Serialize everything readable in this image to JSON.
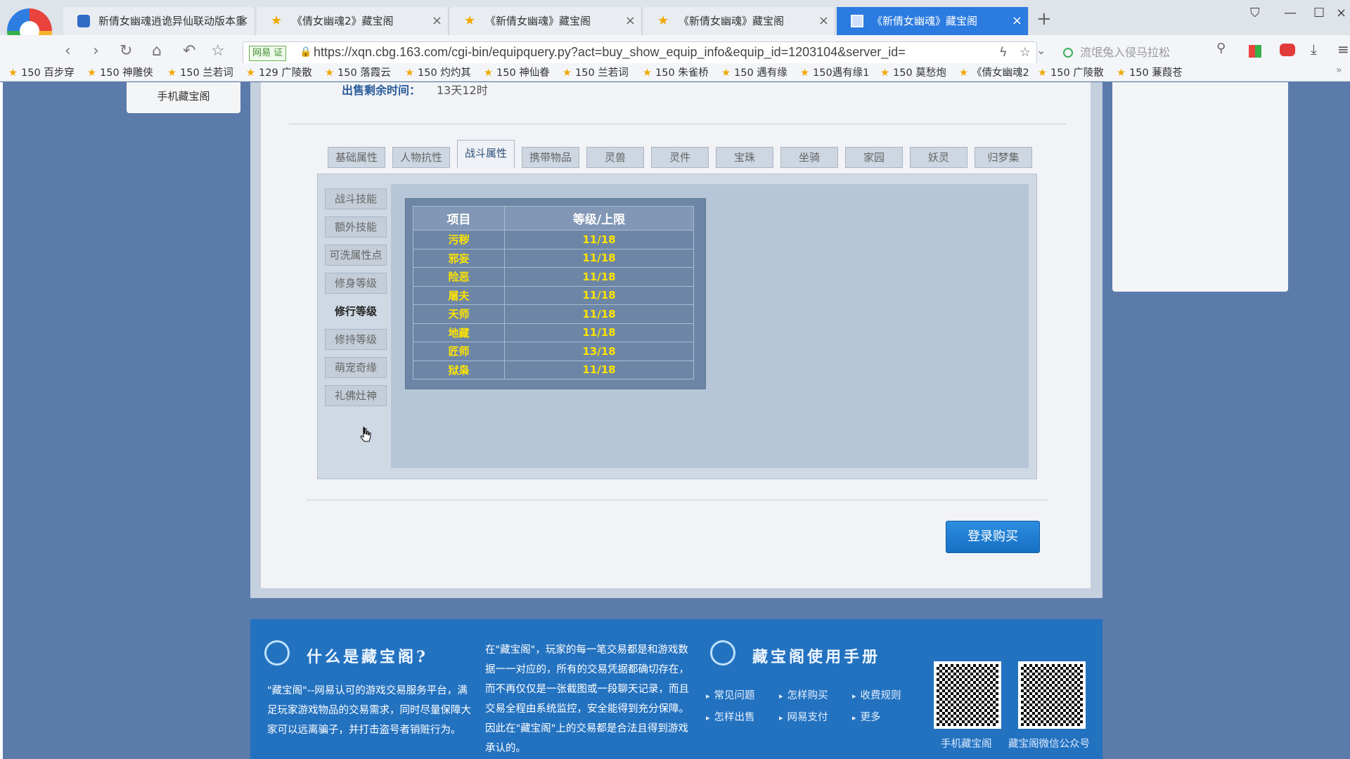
{
  "browser": {
    "tabs": [
      {
        "title": "新倩女幽魂逍诡异仙联动版本重",
        "icon": "game-icon"
      },
      {
        "title": "《倩女幽魂2》藏宝阁",
        "icon": "star-icon"
      },
      {
        "title": "《新倩女幽魂》藏宝阁",
        "icon": "star-icon"
      },
      {
        "title": "《新倩女幽魂》藏宝阁",
        "icon": "star-icon"
      },
      {
        "title": "《新倩女幽魂》藏宝阁",
        "icon": "page-icon",
        "active": true
      }
    ],
    "secure_badge": "网易 证",
    "url": "https://xqn.cbg.163.com/cgi-bin/equipquery.py?act=buy_show_equip_info&equip_id=1203104&server_id=",
    "search_placeholder": "流氓兔入侵马拉松",
    "bookmarks": [
      "150 百步穿",
      "150 神雕侠",
      "150 兰若词",
      "129 广陵散",
      "150 落霞云",
      "150 灼灼其",
      "150 神仙眷",
      "150 兰若词",
      "150 朱雀桥",
      "150 遇有缘",
      "150遇有缘1",
      "150 莫愁炮",
      "《倩女幽魂2",
      "150 广陵散",
      "150 蒹葭苍"
    ]
  },
  "page": {
    "mobile_cbg": "手机藏宝阁",
    "remaining_label": "出售剩余时间：",
    "remaining_value": "13天12时",
    "tabs": [
      "基础属性",
      "人物抗性",
      "战斗属性",
      "携带物品",
      "灵兽",
      "灵件",
      "宝珠",
      "坐骑",
      "家园",
      "妖灵",
      "归梦集"
    ],
    "active_tab": "战斗属性",
    "side_menu": [
      "战斗技能",
      "额外技能",
      "可洗属性点",
      "修身等级",
      "修行等级",
      "修持等级",
      "萌宠奇缘",
      "礼佛灶神"
    ],
    "active_side": "修行等级",
    "table": {
      "headers": [
        "项目",
        "等级/上限"
      ],
      "rows": [
        [
          "污秽",
          "11/18"
        ],
        [
          "邪妄",
          "11/18"
        ],
        [
          "险恶",
          "11/18"
        ],
        [
          "屠夫",
          "11/18"
        ],
        [
          "天师",
          "11/18"
        ],
        [
          "地藏",
          "11/18"
        ],
        [
          "匠师",
          "13/18"
        ],
        [
          "狱枭",
          "11/18"
        ]
      ]
    },
    "buy_button": "登录购买"
  },
  "footer": {
    "what_title": "什么是藏宝阁?",
    "what_text": "\"藏宝阁\"--网易认可的游戏交易服务平台，满足玩家游戏物品的交易需求，同时尽量保障大家可以远离骗子，并打击盗号者销赃行为。",
    "middle_text": "在\"藏宝阁\"，玩家的每一笔交易都是和游戏数据一一对应的，所有的交易凭据都确切存在，而不再仅仅是一张截图或一段聊天记录，而且交易全程由系统监控，安全能得到充分保障。因此在\"藏宝阁\"上的交易都是合法且得到游戏承认的。",
    "manual_title": "藏宝阁使用手册",
    "links": [
      "常见问题",
      "怎样购买",
      "收费规则",
      "怎样出售",
      "网易支付",
      "更多"
    ],
    "qr_labels": [
      "手机藏宝阁",
      "藏宝阁微信公众号"
    ]
  },
  "colors": {
    "accent": "#2372c0",
    "table_value": "#ffe400",
    "page_bg": "#5b7baa"
  }
}
